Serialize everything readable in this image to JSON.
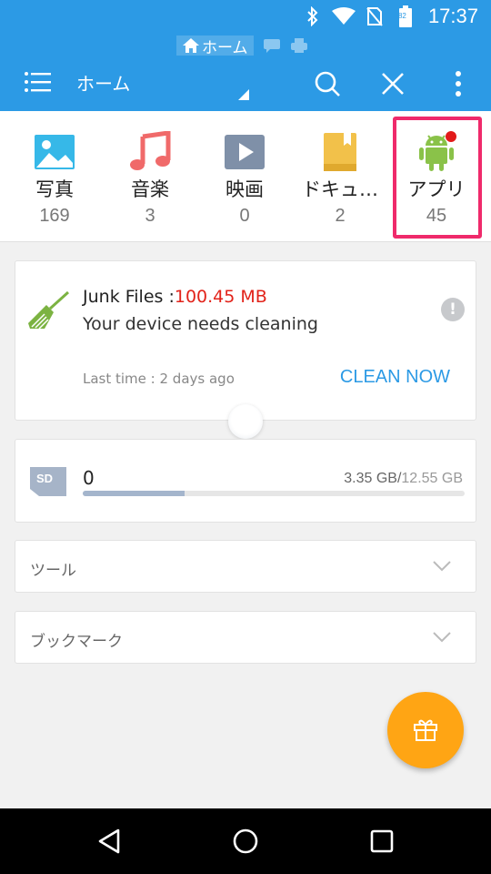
{
  "status_bar": {
    "time": "17:37",
    "battery_level": "82"
  },
  "app_bar": {
    "tab_label": "ホーム",
    "title": "ホーム"
  },
  "categories": [
    {
      "label": "写真",
      "count": "169",
      "icon": "image-icon"
    },
    {
      "label": "音楽",
      "count": "3",
      "icon": "music-note-icon"
    },
    {
      "label": "映画",
      "count": "0",
      "icon": "video-play-icon"
    },
    {
      "label": "ドキュ…",
      "count": "2",
      "icon": "book-icon"
    },
    {
      "label": "アプリ",
      "count": "45",
      "icon": "android-icon"
    }
  ],
  "junk": {
    "title_prefix": "Junk Files :",
    "size": "100.45 MB",
    "subtitle": "Your device needs cleaning",
    "last_time": "Last time : 2 days ago",
    "action": "CLEAN NOW",
    "info_mark": "!"
  },
  "storage": {
    "label": "0",
    "used": "3.35 GB",
    "separator": "/",
    "total": "12.55 GB",
    "used_fraction": 0.267
  },
  "sections": {
    "tools": "ツール",
    "bookmarks": "ブックマーク"
  },
  "colors": {
    "primary": "#2c9ae5",
    "accent_red": "#e2231a",
    "fab": "#ffa514",
    "highlight": "#ef2a6b"
  }
}
